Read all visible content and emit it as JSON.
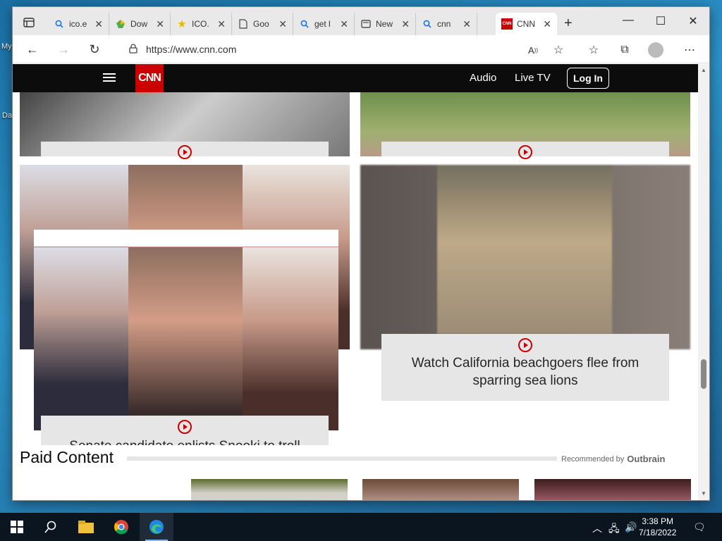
{
  "desktop": {
    "icon1_label": "My",
    "icon2_label": "Da"
  },
  "browser": {
    "tabs": [
      {
        "label": "ico.e",
        "icon": "search-icon"
      },
      {
        "label": "Dow",
        "icon": "download-icon"
      },
      {
        "label": "ICO.",
        "icon": "star-icon"
      },
      {
        "label": "Goo",
        "icon": "document-icon"
      },
      {
        "label": "get l",
        "icon": "search-icon"
      },
      {
        "label": "New",
        "icon": "newtab-icon"
      },
      {
        "label": "cnn",
        "icon": "search-icon"
      },
      {
        "label": "CNN",
        "icon": "cnn-icon",
        "active": true
      }
    ],
    "url": "https://www.cnn.com"
  },
  "cnn": {
    "logo": "CNN",
    "nav": {
      "audio": "Audio",
      "live_tv": "Live TV",
      "login": "Log In"
    },
    "story_right_headline": "Watch California beachgoers flee from sparring sea lions",
    "story_left_headline": "Senate candidate enlists Snooki to troll",
    "paid_content": "Paid Content",
    "recommended_by": "Recommended by",
    "outbrain": "Outbrain"
  },
  "taskbar": {
    "time": "3:38 PM",
    "date": "7/18/2022"
  },
  "colors": {
    "cnn_red": "#cc0000",
    "nav_bg": "#0c0c0c"
  }
}
